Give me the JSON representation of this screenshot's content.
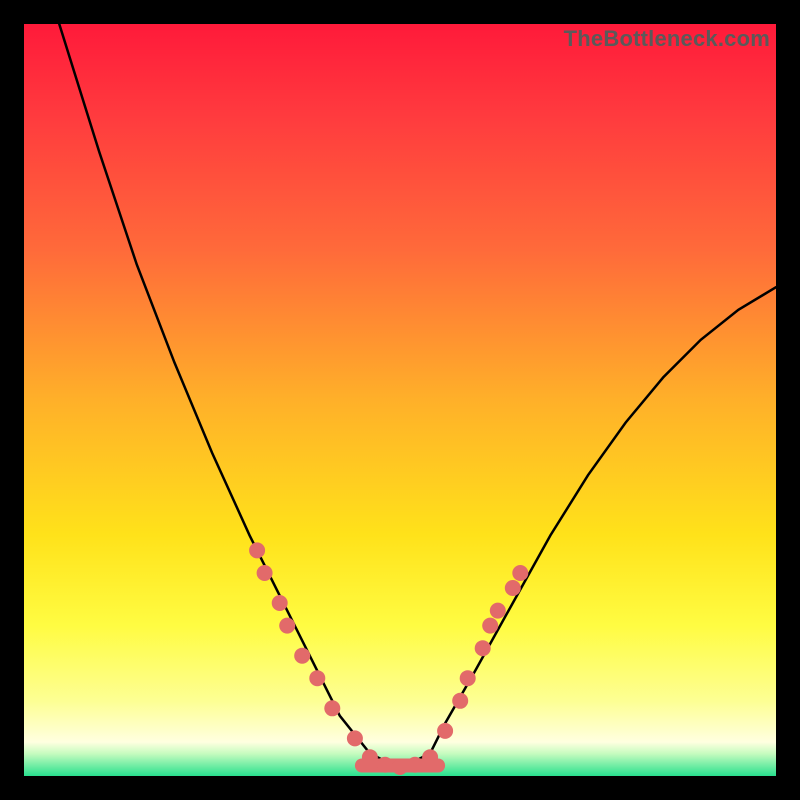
{
  "watermark": {
    "text": "TheBottleneck.com"
  },
  "chart_data": {
    "type": "line",
    "title": "",
    "xlabel": "",
    "ylabel": "",
    "xlim": [
      0,
      100
    ],
    "ylim": [
      0,
      100
    ],
    "series": [
      {
        "name": "bottleneck-curve",
        "x": [
          0,
          5,
          10,
          15,
          20,
          25,
          30,
          35,
          40,
          42,
          46,
          50,
          54,
          56,
          60,
          65,
          70,
          75,
          80,
          85,
          90,
          95,
          100
        ],
        "values": [
          115,
          99,
          83,
          68,
          55,
          43,
          32,
          22,
          12,
          8,
          3,
          1,
          3,
          7,
          14,
          23,
          32,
          40,
          47,
          53,
          58,
          62,
          65
        ]
      }
    ],
    "markers": {
      "name": "highlighted-points",
      "color": "#e26a6a",
      "points": [
        {
          "x": 31,
          "y": 30
        },
        {
          "x": 32,
          "y": 27
        },
        {
          "x": 34,
          "y": 23
        },
        {
          "x": 35,
          "y": 20
        },
        {
          "x": 37,
          "y": 16
        },
        {
          "x": 39,
          "y": 13
        },
        {
          "x": 41,
          "y": 9
        },
        {
          "x": 44,
          "y": 5
        },
        {
          "x": 46,
          "y": 2.5
        },
        {
          "x": 48,
          "y": 1.5
        },
        {
          "x": 50,
          "y": 1.2
        },
        {
          "x": 52,
          "y": 1.5
        },
        {
          "x": 54,
          "y": 2.5
        },
        {
          "x": 56,
          "y": 6
        },
        {
          "x": 58,
          "y": 10
        },
        {
          "x": 59,
          "y": 13
        },
        {
          "x": 61,
          "y": 17
        },
        {
          "x": 62,
          "y": 20
        },
        {
          "x": 63,
          "y": 22
        },
        {
          "x": 65,
          "y": 25
        },
        {
          "x": 66,
          "y": 27
        }
      ]
    },
    "flat_segment": {
      "name": "valley-bar",
      "color": "#e26a6a",
      "x_start": 44,
      "x_end": 56,
      "y": 1.4
    },
    "background_gradient": {
      "stops": [
        {
          "pos": 0,
          "color": "#ff1a3a"
        },
        {
          "pos": 50,
          "color": "#ffb029"
        },
        {
          "pos": 80,
          "color": "#fffc42"
        },
        {
          "pos": 97,
          "color": "#c7fcbf"
        },
        {
          "pos": 100,
          "color": "#28e08e"
        }
      ]
    }
  }
}
